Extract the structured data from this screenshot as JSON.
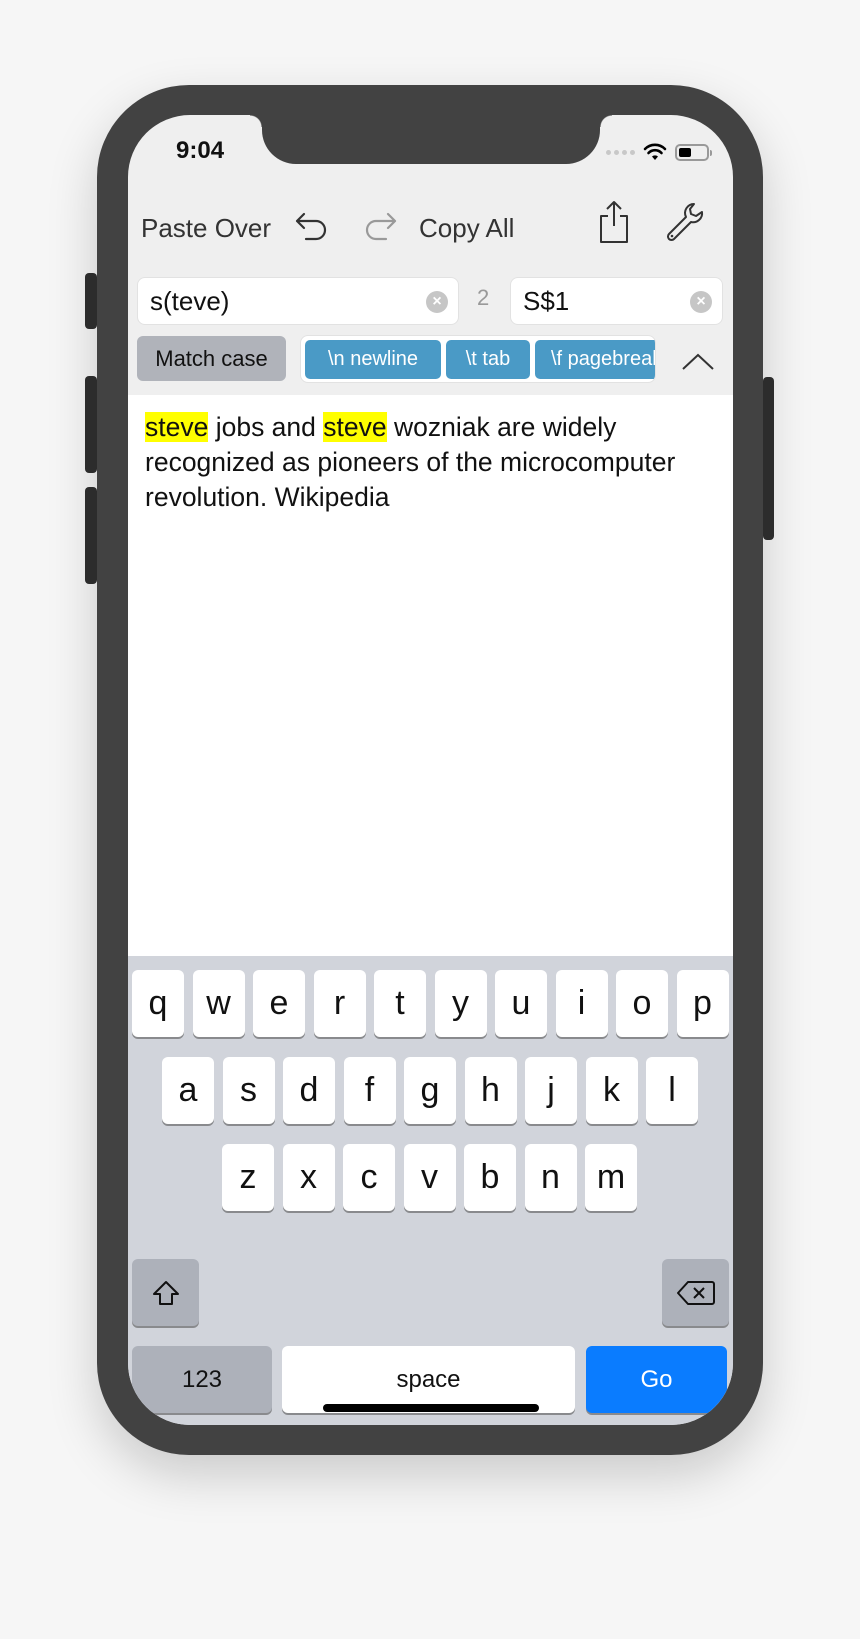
{
  "status_bar": {
    "time": "9:04",
    "wifi_icon": "wifi-icon",
    "battery_icon": "battery-icon"
  },
  "toolbar": {
    "paste_over": "Paste Over",
    "undo_icon": "undo-icon",
    "redo_icon": "redo-icon",
    "copy_all": "Copy All",
    "share_icon": "share-icon",
    "settings_icon": "wrench-icon"
  },
  "search": {
    "find_value": "s(teve)",
    "match_count": "2",
    "replace_value": "S$1",
    "clear_icon": "clear-icon"
  },
  "options": {
    "match_case": "Match case",
    "chips": [
      "\\n newline",
      "\\t tab",
      "\\f pagebreak"
    ],
    "collapse_icon": "chevron-up-icon"
  },
  "document": {
    "segments": [
      {
        "text": "steve",
        "highlight": true
      },
      {
        "text": " jobs and ",
        "highlight": false
      },
      {
        "text": "steve",
        "highlight": true
      },
      {
        "text": " wozniak are widely recognized as pioneers of the microcomputer revolution. Wikipedia",
        "highlight": false
      }
    ],
    "highlight_color": "#ffff00"
  },
  "keyboard": {
    "row1": [
      "q",
      "w",
      "e",
      "r",
      "t",
      "y",
      "u",
      "i",
      "o",
      "p"
    ],
    "row2": [
      "a",
      "s",
      "d",
      "f",
      "g",
      "h",
      "j",
      "k",
      "l"
    ],
    "row3": [
      "z",
      "x",
      "c",
      "v",
      "b",
      "n",
      "m"
    ],
    "numbers": "123",
    "space": "space",
    "go": "Go",
    "go_color": "#0a7cff"
  }
}
